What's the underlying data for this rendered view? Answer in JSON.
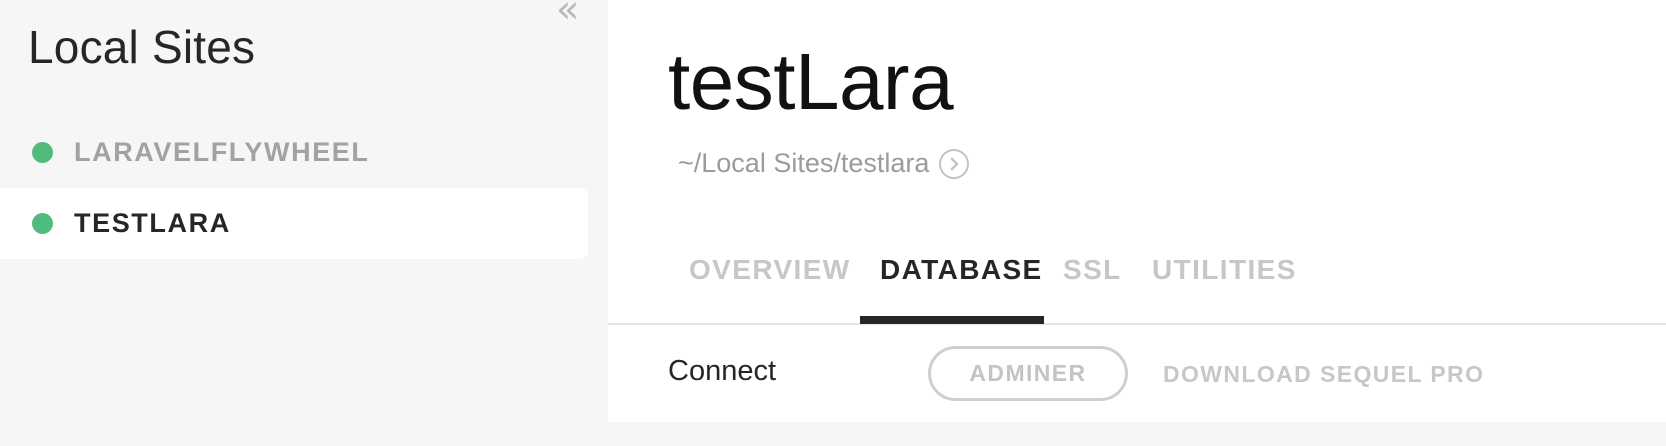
{
  "sidebar": {
    "collapse_glyph": "«",
    "title": "Local Sites",
    "sites": [
      {
        "name": "LARAVELFLYWHEEL",
        "status": "running",
        "selected": false
      },
      {
        "name": "TESTLARA",
        "status": "running",
        "selected": true
      }
    ]
  },
  "main": {
    "title": "testLara",
    "path": "~/Local Sites/testlara",
    "tabs": [
      {
        "label": "OVERVIEW",
        "active": false
      },
      {
        "label": "DATABASE",
        "active": true
      },
      {
        "label": "SSL",
        "active": false
      },
      {
        "label": "UTILITIES",
        "active": false
      }
    ],
    "database": {
      "connect_label": "Connect",
      "adminer_label": "ADMINER",
      "sequel_label": "DOWNLOAD SEQUEL PRO"
    }
  },
  "icons": {
    "collapse": "double-chevron-left-icon",
    "reveal": "arrow-circle-right-icon",
    "status": "status-dot-icon"
  },
  "colors": {
    "status_running": "#51bb7b",
    "sidebar_bg": "#f6f6f6",
    "active_text": "#262626",
    "inactive_text": "#c7c7c7"
  }
}
